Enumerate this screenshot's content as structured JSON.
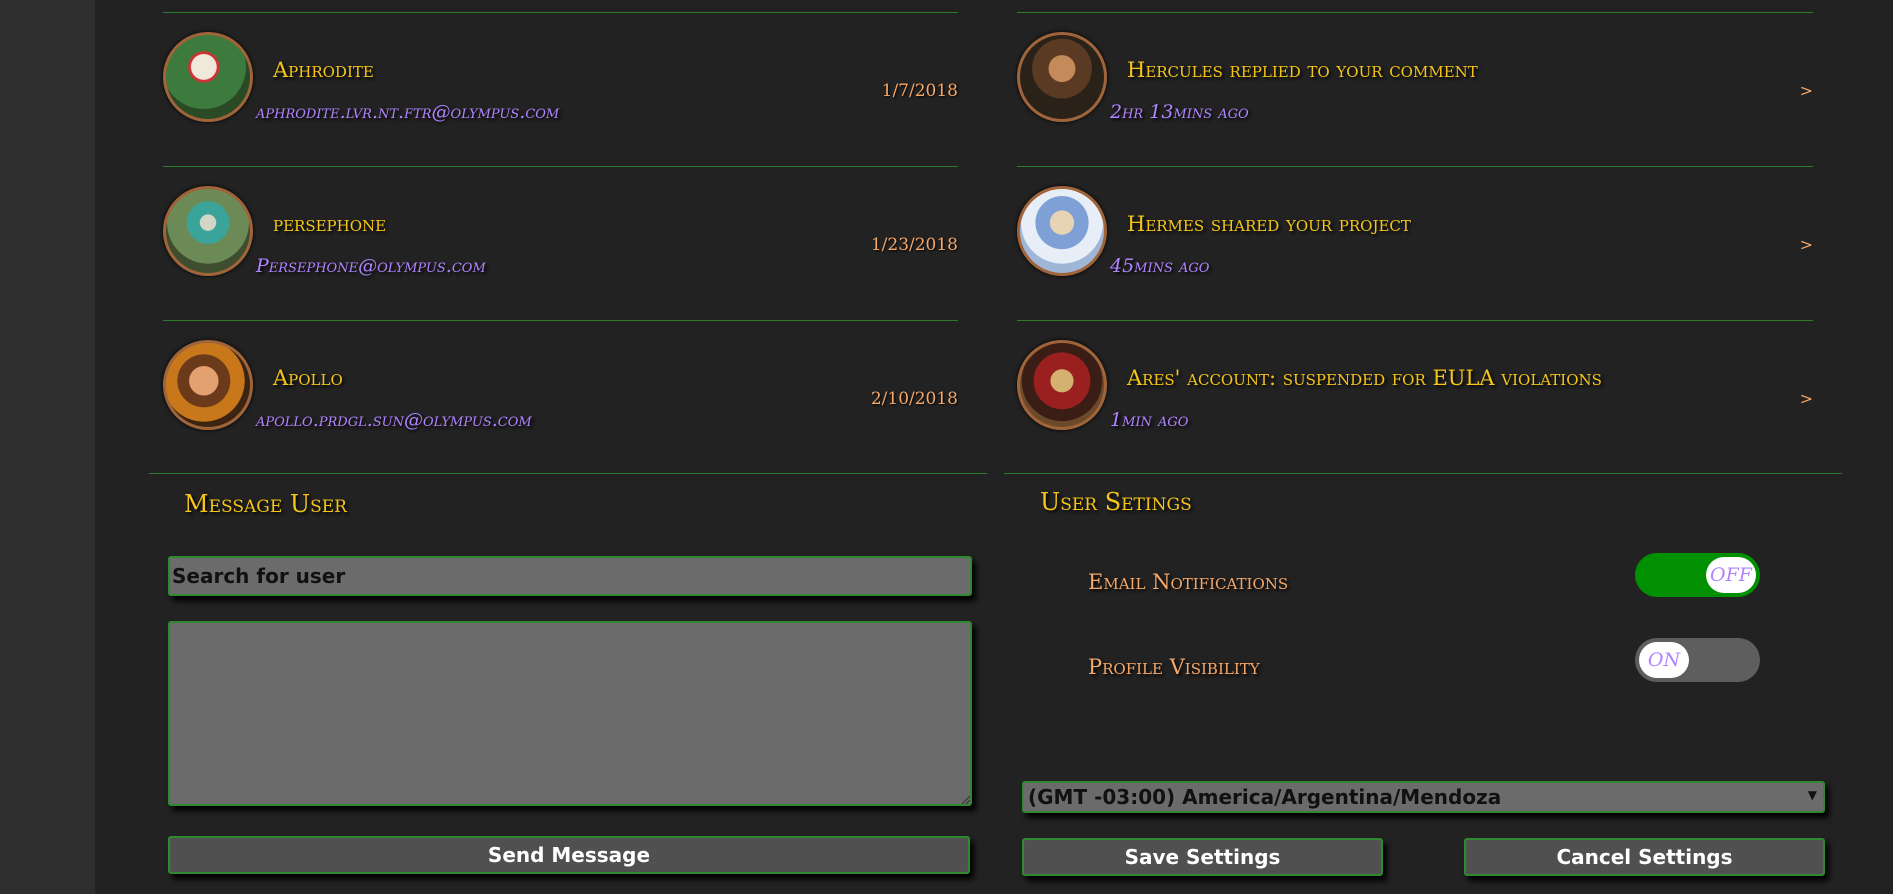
{
  "activity": {
    "users": [
      {
        "name": "Aphrodite",
        "email": "aphrodite.lvr.nt.ftr@olympus.com",
        "date": "1/7/2018"
      },
      {
        "name": "persephone",
        "email": "Persephone@olympus.com",
        "date": "1/23/2018"
      },
      {
        "name": "Apollo",
        "email": "apollo.prdgl.sun@olympus.com",
        "date": "2/10/2018"
      }
    ],
    "notifications": [
      {
        "title": "Hercules replied to your comment",
        "time": "2hr 13mins ago",
        "arrow": ">"
      },
      {
        "title": "Hermes shared your project",
        "time": "45mins ago",
        "arrow": ">"
      },
      {
        "title": "Ares' account: suspended for EULA violations",
        "time": "1min ago",
        "arrow": ">"
      }
    ]
  },
  "message_user": {
    "title": "Message User",
    "search_placeholder": "Search for user",
    "message_value": "",
    "send_label": "Send Message"
  },
  "user_settings": {
    "title": "User Setings",
    "email_notifications": {
      "label": "Email Notifications",
      "state_text": "OFF"
    },
    "profile_visibility": {
      "label": "Profile Visibility",
      "state_text": "ON"
    },
    "timezone": "(GMT -03:00) America/Argentina/Mendoza",
    "save_label": "Save Settings",
    "cancel_label": "Cancel Settings"
  },
  "colors": {
    "title_gold": "#f5c518",
    "subtitle_purple": "#b084ff",
    "accent_orange": "#f6a868",
    "divider_green": "#2c7a2c",
    "toggle_green": "#019001"
  }
}
